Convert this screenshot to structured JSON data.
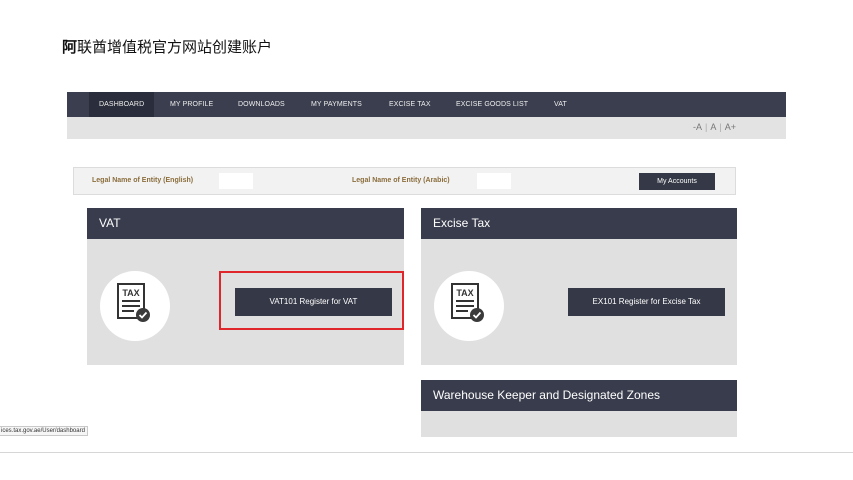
{
  "slide_title": {
    "lead": "阿",
    "rest": "联酋增值税官方网站创建账户"
  },
  "nav": {
    "items": [
      {
        "label": "DASHBOARD",
        "active": true
      },
      {
        "label": "MY PROFILE",
        "active": false
      },
      {
        "label": "DOWNLOADS",
        "active": false
      },
      {
        "label": "MY PAYMENTS",
        "active": false
      },
      {
        "label": "EXCISE TAX",
        "active": false
      },
      {
        "label": "EXCISE GOODS LIST",
        "active": false
      },
      {
        "label": "VAT",
        "active": false
      }
    ]
  },
  "font_sizer": {
    "decrease": "-A",
    "normal": "A",
    "increase": "A+",
    "separator": "|"
  },
  "entity": {
    "english_label": "Legal Name of Entity (English)",
    "english_value": "",
    "arabic_label": "Legal Name of Entity (Arabic)",
    "arabic_value": "",
    "accounts_button": "My Accounts"
  },
  "panels": {
    "vat": {
      "title": "VAT",
      "icon_text": "TAX",
      "button": "VAT101 Register for VAT"
    },
    "excise": {
      "title": "Excise Tax",
      "icon_text": "TAX",
      "button": "EX101 Register for Excise Tax"
    },
    "warehouse": {
      "title": "Warehouse Keeper and Designated Zones"
    }
  },
  "status_url": "ices.tax.gov.ae/User/dashboard",
  "colors": {
    "nav_bg": "#3b3e4e",
    "panel_header": "#393c4c",
    "button_bg": "#353846",
    "panel_body": "#e0e0e0",
    "highlight": "#e0262a",
    "entity_label": "#8a6d3b"
  },
  "icons": {
    "tax_document": "tax-document-icon",
    "checkmark": "checkmark-icon"
  }
}
